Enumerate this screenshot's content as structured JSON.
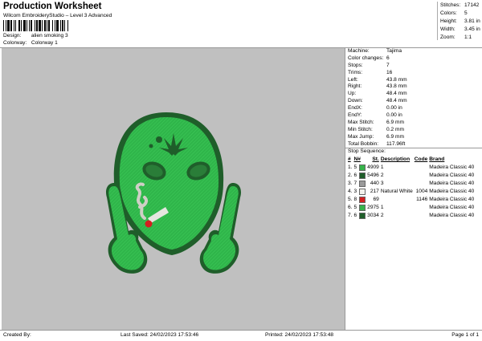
{
  "header": {
    "title": "Production Worksheet",
    "subtitle": "Wilcom EmbroideryStudio – Level 3 Advanced",
    "design_label": "Design:",
    "design_value": "alien smoking 3",
    "colorway_label": "Colorway:",
    "colorway_value": "Colorway 1"
  },
  "summary": {
    "stitches_label": "Stitches:",
    "stitches": "17142",
    "colors_label": "Colors:",
    "colors": "5",
    "height_label": "Height:",
    "height": "3.81 in",
    "width_label": "Width:",
    "width": "3.45 in",
    "zoom_label": "Zoom:",
    "zoom": "1:1"
  },
  "info": [
    {
      "k": "Machine:",
      "v": "Tajima"
    },
    {
      "k": "Color changes:",
      "v": "6"
    },
    {
      "k": "Stops:",
      "v": "7"
    },
    {
      "k": "Trims:",
      "v": "16"
    },
    {
      "k": "Left:",
      "v": "43.8 mm"
    },
    {
      "k": "Right:",
      "v": "43.8 mm"
    },
    {
      "k": "Up:",
      "v": "48.4 mm"
    },
    {
      "k": "Down:",
      "v": "48.4 mm"
    },
    {
      "k": "EndX:",
      "v": "0.00 in"
    },
    {
      "k": "EndY:",
      "v": "0.00 in"
    },
    {
      "k": "Max Stitch:",
      "v": "6.9 mm"
    },
    {
      "k": "Min Stitch:",
      "v": "0.2 mm"
    },
    {
      "k": "Max Jump:",
      "v": "6.9 mm"
    },
    {
      "k": "Total Bobbin:",
      "v": "117.96ft"
    }
  ],
  "stop_sequence": {
    "title": "Stop Sequence:",
    "headers": [
      "#",
      "N#",
      "St.",
      "Description",
      "Code",
      "Brand"
    ],
    "rows": [
      {
        "n": "1.",
        "nn": "5",
        "color": "#36b34a",
        "st": "4909",
        "desc": "1",
        "code": "",
        "brand": "Madeira Classic 40"
      },
      {
        "n": "2.",
        "nn": "6",
        "color": "#1f5e2a",
        "st": "5496",
        "desc": "2",
        "code": "",
        "brand": "Madeira Classic 40"
      },
      {
        "n": "3.",
        "nn": "7",
        "color": "#9a9a9a",
        "st": "440",
        "desc": "3",
        "code": "",
        "brand": "Madeira Classic 40"
      },
      {
        "n": "4.",
        "nn": "3",
        "color": "#f2f2ec",
        "st": "217",
        "desc": "Natural White",
        "code": "1004",
        "brand": "Madeira Classic 40"
      },
      {
        "n": "5.",
        "nn": "8",
        "color": "#d42020",
        "st": "69",
        "desc": "",
        "code": "1146",
        "brand": "Madeira Classic 40"
      },
      {
        "n": "6.",
        "nn": "5",
        "color": "#36b34a",
        "st": "2975",
        "desc": "1",
        "code": "",
        "brand": "Madeira Classic 40"
      },
      {
        "n": "7.",
        "nn": "6",
        "color": "#1f5e2a",
        "st": "3034",
        "desc": "2",
        "code": "",
        "brand": "Madeira Classic 40"
      }
    ]
  },
  "footer": {
    "created_by": "Created By:",
    "last_saved": "Last Saved: 24/02/2023 17:53:46",
    "printed": "Printed: 24/02/2023 17:53:48",
    "page": "Page 1 of 1"
  }
}
